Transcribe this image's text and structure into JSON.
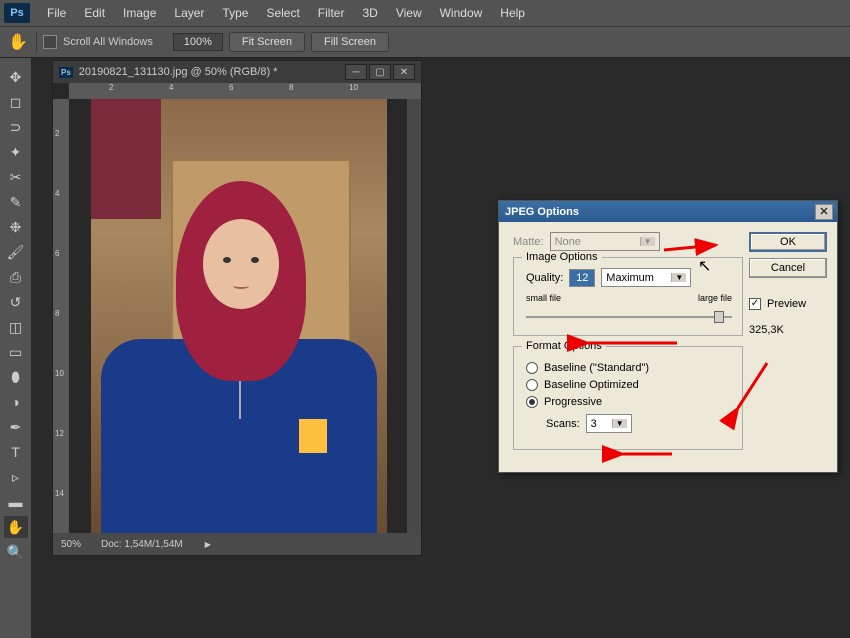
{
  "app": {
    "logo": "Ps"
  },
  "menu": [
    "File",
    "Edit",
    "Image",
    "Layer",
    "Type",
    "Select",
    "Filter",
    "3D",
    "View",
    "Window",
    "Help"
  ],
  "options": {
    "scrollAll": "Scroll All Windows",
    "zoom": "100%",
    "fitScreen": "Fit Screen",
    "fillScreen": "Fill Screen"
  },
  "doc": {
    "title": "20190821_131130.jpg @ 50% (RGB/8) *",
    "zoom": "50%",
    "docSize": "Doc: 1,54M/1,54M",
    "rulerH": {
      "n2": "2",
      "n4": "4",
      "n6": "6",
      "n8": "8",
      "n10": "10"
    },
    "rulerV": {
      "n2": "2",
      "n4": "4",
      "n6": "6",
      "n8": "8",
      "n10": "10",
      "n12": "12",
      "n14": "14"
    }
  },
  "dialog": {
    "title": "JPEG Options",
    "ok": "OK",
    "cancel": "Cancel",
    "preview": "Preview",
    "filesize": "325,3K",
    "matteLabel": "Matte:",
    "matteValue": "None",
    "imgOptionsLegend": "Image Options",
    "qualityLabel": "Quality:",
    "qualityValue": "12",
    "qualityPreset": "Maximum",
    "smallFile": "small file",
    "largeFile": "large file",
    "formatLegend": "Format Options",
    "baselineStd": "Baseline (\"Standard\")",
    "baselineOpt": "Baseline Optimized",
    "progressive": "Progressive",
    "scansLabel": "Scans:",
    "scansValue": "3"
  }
}
